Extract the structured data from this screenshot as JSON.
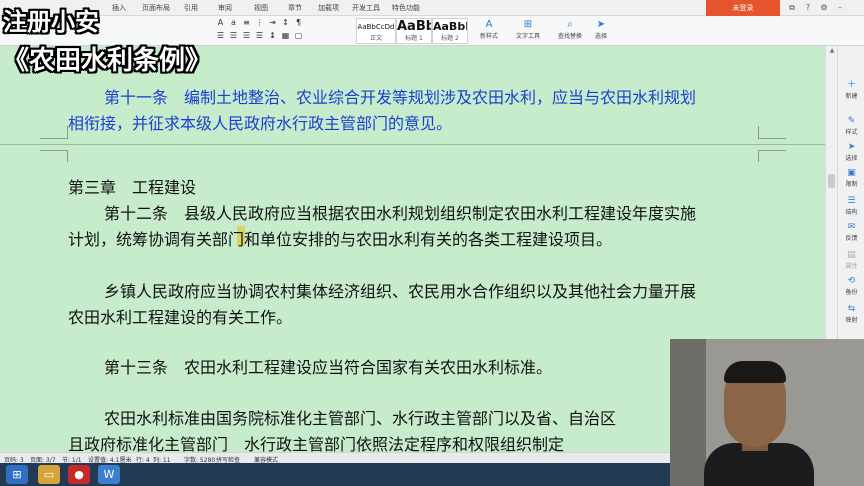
{
  "menu_tabs": [
    "插入",
    "页面布局",
    "引用",
    "审阅",
    "视图",
    "章节",
    "加载项",
    "开发工具",
    "特色功能"
  ],
  "login_button": "未登录",
  "window_controls": [
    "restore-icon",
    "help-icon",
    "settings-icon",
    "minimize-icon"
  ],
  "ribbon": {
    "styles": [
      {
        "sample": "AaBbCcDd",
        "label": "正文"
      },
      {
        "sample": "AaBb",
        "label": "标题 1"
      },
      {
        "sample": "AaBbI",
        "label": "标题 2"
      }
    ],
    "new_style": "新样式",
    "text_tools": "文字工具",
    "find_replace": "查找替换",
    "select": "选择"
  },
  "document": {
    "lines": [
      {
        "text": "第十一条　编制土地整治、农业综合开发等规划涉及农田水利，应当与农田水利规划",
        "style": "blue"
      },
      {
        "text": "相衔接，并征求本级人民政府水行政主管部门的意见。",
        "style": "blue"
      },
      {
        "text": "第三章　工程建设",
        "style": "normal"
      },
      {
        "text": "第十二条　县级人民政府应当根据农田水利规划组织制定农田水利工程建设年度实施",
        "style": "normal"
      },
      {
        "text": "计划，统筹协调有关部门和单位安排的与农田水利有关的各类工程建设项目。",
        "style": "normal"
      },
      {
        "text": "乡镇人民政府应当协调农村集体经济组织、农民用水合作组织以及其他社会力量开展",
        "style": "normal"
      },
      {
        "text": "农田水利工程建设的有关工作。",
        "style": "normal"
      },
      {
        "text": "第十三条　农田水利工程建设应当符合国家有关农田水利标准。",
        "style": "normal"
      },
      {
        "text": "农田水利标准由国务院标准化主管部门、水行政主管部门以及省、自治区",
        "style": "normal"
      },
      {
        "text": "且政府标准化主管部门　水行政主管部门依照法定程序和权限组织制定",
        "style": "normal"
      }
    ]
  },
  "task_pane": [
    {
      "label": "新建",
      "icon": "new-icon"
    },
    {
      "label": "样式",
      "icon": "style-icon"
    },
    {
      "label": "选择",
      "icon": "select-icon"
    },
    {
      "label": "限制",
      "icon": "restrict-icon"
    },
    {
      "label": "结构",
      "icon": "structure-icon"
    },
    {
      "label": "反馈",
      "icon": "feedback-icon"
    },
    {
      "label": "属性",
      "icon": "properties-icon"
    },
    {
      "label": "备份",
      "icon": "backup-icon"
    },
    {
      "label": "映射",
      "icon": "mapping-icon"
    }
  ],
  "status_bar": {
    "page": "页码: 3",
    "pages": "页面: 3/7",
    "section": "节: 1/1",
    "setting": "设置值: 4.1厘米",
    "row": "行: 4",
    "column": "列: 11",
    "word_count": "字数: 5280",
    "spell_check": "拼写检查",
    "compat": "兼容模式"
  },
  "captions": {
    "top": "注册小安",
    "title": "《农田水利条例》"
  }
}
